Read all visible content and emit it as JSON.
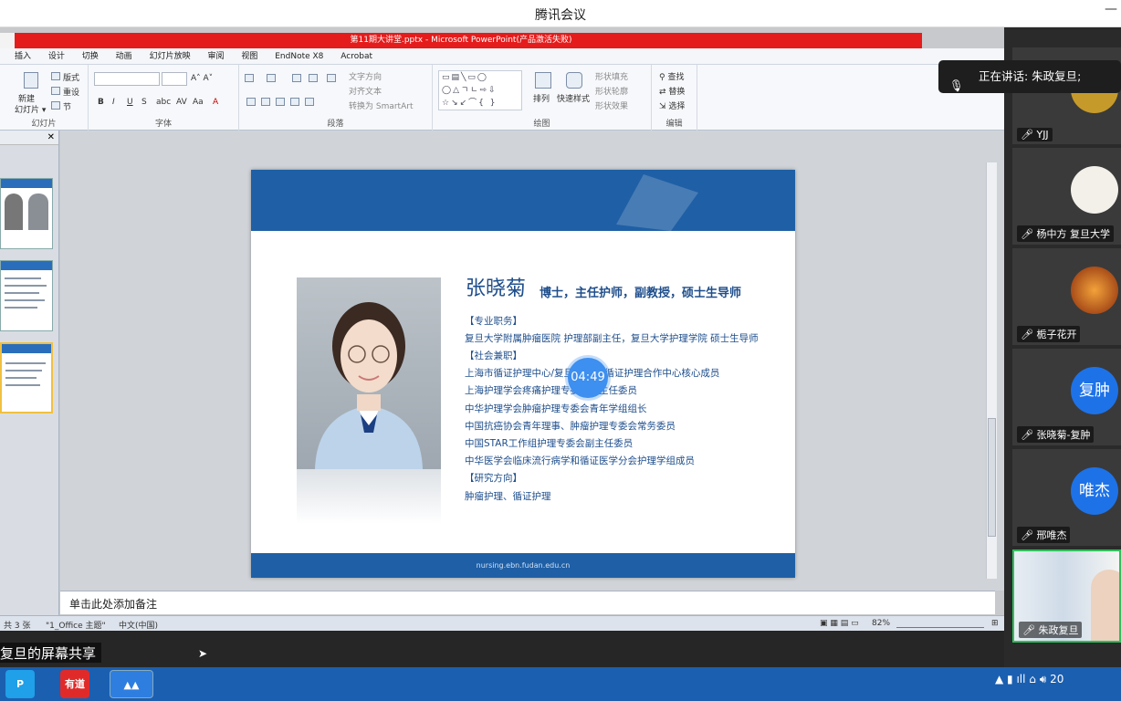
{
  "window": {
    "title": "腾讯会议",
    "minimize": "—"
  },
  "powerpoint": {
    "title": "第11期大讲堂.pptx  -  Microsoft PowerPoint(产品激活失败)",
    "menu": [
      "插入",
      "设计",
      "切换",
      "动画",
      "幻灯片放映",
      "审阅",
      "视图",
      "EndNote X8",
      "Acrobat"
    ],
    "ribbon": {
      "slides_group": {
        "label": "幻灯片",
        "new_slide": "新建\n幻灯片",
        "layout": "版式",
        "reset": "重设",
        "section": "节"
      },
      "font_group": {
        "label": "字体"
      },
      "paragraph_group": {
        "label": "段落",
        "text_direction": "文字方向",
        "align_text": "对齐文本",
        "smartart": "转换为 SmartArt"
      },
      "drawing_group": {
        "label": "绘图",
        "arrange": "排列",
        "quick_styles": "快速样式",
        "shape_fill": "形状填充",
        "shape_outline": "形状轮廓",
        "shape_effects": "形状效果"
      },
      "editing_group": {
        "label": "编辑",
        "find": "查找",
        "replace": "替换",
        "select": "选择"
      }
    },
    "slide": {
      "name": "张晓菊",
      "subtitle": "博士，主任护师，副教授，硕士生导师",
      "lines": [
        "【专业职务】",
        "复旦大学附属肿瘤医院 护理部副主任，复旦大学护理学院 硕士生导师",
        "【社会兼职】",
        "上海市循证护理中心/复旦大学JBI循证护理合作中心核心成员",
        "上海护理学会疼痛护理专委会副主任委员",
        "中华护理学会肿瘤护理专委会青年学组组长",
        "中国抗癌协会青年理事、肿瘤护理专委会常务委员",
        "中国STAR工作组护理专委会副主任委员",
        "中华医学会临床流行病学和循证医学分会护理学组成员",
        "【研究方向】",
        "肿瘤护理、循证护理"
      ],
      "footer_url": "nursing.ebn.fudan.edu.cn"
    },
    "notes_placeholder": "单击此处添加备注",
    "status": {
      "slides": "共 3 张",
      "theme": "\"1_Office 主题\"",
      "language": "中文(中国)",
      "zoom": "82%"
    }
  },
  "timer": "04:49",
  "speaking": "正在讲话: 朱政复旦;",
  "participants": [
    {
      "name": "YJJ",
      "avatar_text": ""
    },
    {
      "name": "杨中方 复旦大学",
      "avatar_text": ""
    },
    {
      "name": "栀子花开",
      "avatar_text": ""
    },
    {
      "name": "张晓菊-复肿",
      "avatar_text": "复肿"
    },
    {
      "name": "邢唯杰",
      "avatar_text": "唯杰"
    },
    {
      "name": "朱政复旦",
      "avatar_text": ""
    }
  ],
  "share_label": "复旦的屏幕共享",
  "taskbar": {
    "youdao": "有道",
    "clock": "20"
  },
  "colors": {
    "brand_blue": "#1f5fa5",
    "title_red": "#e51c1c",
    "timer_blue": "#3d8ff0",
    "taskbar": "#1b5fb0"
  }
}
